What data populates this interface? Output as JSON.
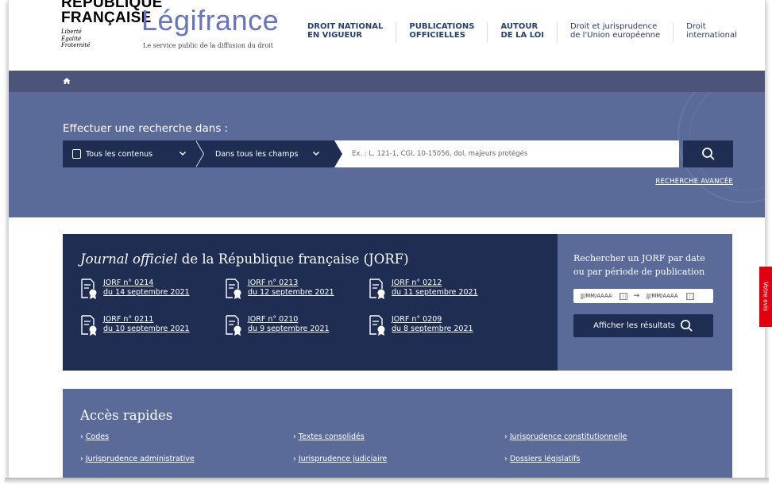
{
  "header": {
    "republique_line1": "RÉPUBLIQUE",
    "republique_line2": "FRANÇAISE",
    "motto": [
      "Liberté",
      "Égalité",
      "Fraternité"
    ],
    "brand": "Légifrance",
    "tagline": "Le service public de la diffusion du droit",
    "nav": [
      {
        "line1": "DROIT NATIONAL",
        "line2": "EN VIGUEUR"
      },
      {
        "line1": "PUBLICATIONS",
        "line2": "OFFICIELLES"
      },
      {
        "line1": "AUTOUR",
        "line2": "DE LA LOI"
      },
      {
        "line1": "Droit et jurisprudence",
        "line2": "de l'Union européenne"
      },
      {
        "line1": "Droit",
        "line2": "international"
      }
    ]
  },
  "search": {
    "label": "Effectuer une recherche dans :",
    "scope": "Tous les contenus",
    "field": "Dans tous les champs",
    "placeholder": "Ex. : L. 121-1, CGI, 10-15056, dol, majeurs protégés",
    "advanced": "RECHERCHE AVANCÉE"
  },
  "jorf": {
    "title_italic": "Journal officiel",
    "title_rest": " de la République française (JORF)",
    "items": [
      {
        "num": "JORF n° 0214",
        "date": "du 14 septembre 2021"
      },
      {
        "num": "JORF n° 0213",
        "date": "du 12 septembre 2021"
      },
      {
        "num": "JORF n° 0212",
        "date": "du 11 septembre 2021"
      },
      {
        "num": "JORF n° 0211",
        "date": "du 10 septembre 2021"
      },
      {
        "num": "JORF n° 0210",
        "date": "du 9 septembre 2021"
      },
      {
        "num": "JORF n° 0209",
        "date": "du 8 septembre 2021"
      }
    ],
    "side_title": "Rechercher un JORF par date ou par période de publication",
    "date_placeholder": "JJ/MM/AAAA",
    "arrow": "→",
    "results_button": "Afficher les résultats"
  },
  "acces": {
    "title": "Accès rapides",
    "links": [
      "Codes",
      "Textes consolidés",
      "Jurisprudence constitutionnelle",
      "Jurisprudence administrative",
      "Jurisprudence judiciaire",
      "Dossiers législatifs"
    ]
  },
  "feedback": "Votre avis"
}
